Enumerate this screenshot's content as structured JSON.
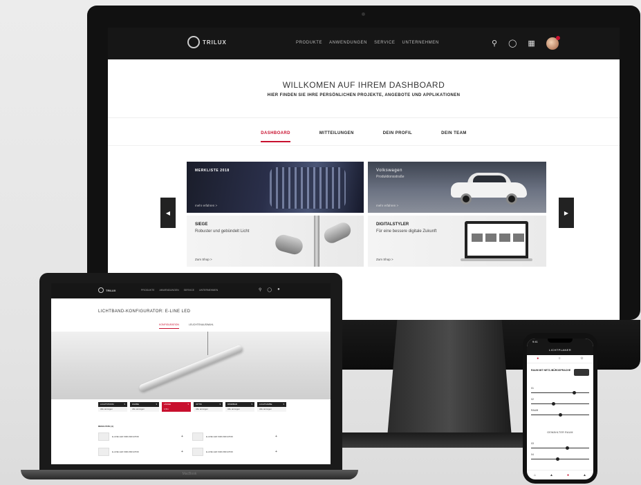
{
  "monitor": {
    "nav": {
      "logo": "TRILUX",
      "links": [
        "PRODUKTE",
        "ANWENDUNGEN",
        "SERVICE",
        "UNTERNEHMEN"
      ],
      "icons": [
        "search-icon",
        "headset-icon",
        "grid-icon",
        "avatar"
      ]
    },
    "title": "WILLKOMEN AUF IHREM DASHBOARD",
    "subtitle": "HIER FINDEN SIE IHRE PERSÖNLICHEN PROJEKTE, ANGEBOTE UND APPLIKATIONEN",
    "tabs": [
      {
        "label": "DASHBOARD",
        "active": true
      },
      {
        "label": "MITTEILUNGEN",
        "active": false
      },
      {
        "label": "DEIN PROFIL",
        "active": false
      },
      {
        "label": "DEIN TEAM",
        "active": false
      }
    ],
    "tiles": {
      "t1": {
        "label": "MERKLISTE 2018",
        "link": "mehr erfahren  >"
      },
      "t2": {
        "label": "Volkswagen",
        "sub": "Produktionsstraße",
        "link": "mehr erfahren  >"
      },
      "t3": {
        "title": "SIEGE",
        "text": "Robuster und gebündelt Licht",
        "link": "Zum Shop  >"
      },
      "t4": {
        "title": "DIGITALSTYLER",
        "text": "Für eine bessere digitale Zukunft",
        "link": "Zum Shop  >"
      }
    },
    "arrows": {
      "left": "◀",
      "right": "▶"
    }
  },
  "laptop": {
    "brand": "MacBook",
    "nav": {
      "logo": "TRILUX",
      "links": [
        "PRODUKTE",
        "ANWENDUNGEN",
        "SERVICE",
        "UNTERNEHMEN"
      ]
    },
    "title": "LICHTBAND-KONFIGURATOR: E-LINE LED",
    "tabs": [
      {
        "label": "KONFIGURATION",
        "active": true
      },
      {
        "label": "LEUCHTENAUSWAHL",
        "active": false
      }
    ],
    "filters": [
      {
        "head": "LICHTSTROM",
        "value": "Alle anzeigen",
        "active": false
      },
      {
        "head": "FARBE",
        "value": "Alle anzeigen",
        "active": false
      },
      {
        "head": "LÄNGE",
        "value": "1,5m",
        "active": true
      },
      {
        "head": "OPTIK",
        "value": "Alle anzeigen",
        "active": false
      },
      {
        "head": "DIMMBAR",
        "value": "Alle anzeigen",
        "active": false
      },
      {
        "head": "LICHTFARBE",
        "value": "Alle anzeigen",
        "active": false
      }
    ],
    "results_label": "RESULTATE (4)",
    "items": [
      {
        "text": "E-LINE LED 6000-840 ETDD",
        "plus": "+"
      },
      {
        "text": "E-LINE LED 6400-840 ETDD",
        "plus": "+"
      },
      {
        "text": "E-LINE LED 6000-830 ETDD",
        "plus": "+"
      },
      {
        "text": "E-LINE LED 6400-830 ETDD",
        "plus": "+"
      }
    ]
  },
  "phone": {
    "time": "9:41",
    "header": "LICHTPLANER",
    "tabs": [
      "●",
      "≡",
      "⚙"
    ],
    "question": "RAUM MIT NETZ-/BÜROSPRACHE",
    "rows": [
      "01",
      "02",
      "RAUM",
      "03",
      "04"
    ],
    "section": "GEWÄHLTER RAUM",
    "bottom_nav": [
      "⌂",
      "▲",
      "●",
      "▲"
    ]
  }
}
